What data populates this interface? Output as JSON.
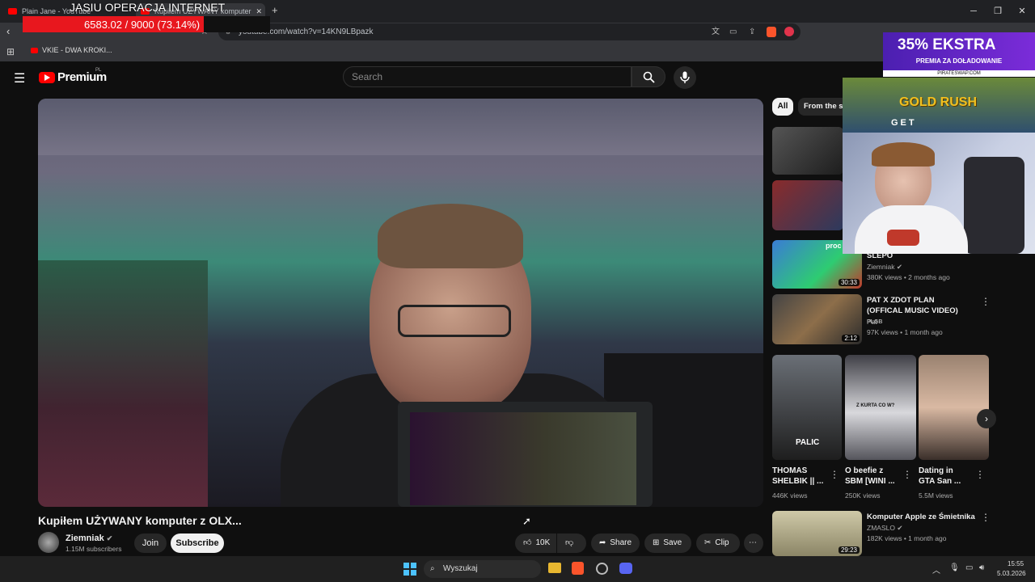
{
  "browser": {
    "tabs": [
      {
        "label": "Plain Jane - YouTube"
      },
      {
        "label": "Kupiłem UŻYWANY komputer"
      }
    ],
    "new_tab": "+",
    "url": "youtube.com/watch?v=14KN9LBpazk",
    "bookmark": "VKIE - DWA KROKI..."
  },
  "youtube": {
    "logo_text": "Premium",
    "logo_region": "PL",
    "search_placeholder": "Search",
    "video": {
      "title": "Kupiłem UŻYWANY komputer z OLX...",
      "channel": "Ziemniak",
      "subscribers": "1.15M subscribers",
      "join": "Join",
      "subscribe": "Subscribe",
      "likes": "10K",
      "share": "Share",
      "save": "Save",
      "clip": "Clip"
    },
    "chips": [
      "All",
      "From the se"
    ],
    "sidebar": [
      {
        "title": "SLEPO",
        "channel": "Ziemniak",
        "meta": "380K views • 2 months ago",
        "duration": "30:33",
        "thumb_text": "proc"
      },
      {
        "title": "PAT X ZDOT PLAN (OFFICAL MUSIC VIDEO)",
        "badge": "PLGB",
        "channel": "Pat",
        "meta": "97K views • 1 month ago",
        "duration": "2:12"
      },
      {
        "title": "Komputer Apple ze Śmietnika",
        "channel": "ZMASLO",
        "meta": "182K views • 1 month ago",
        "duration": "29:23"
      }
    ],
    "shorts": [
      {
        "title": "THOMAS SHELBIK || ...",
        "views": "446K views",
        "thumb_text": "PALIC",
        "color": "#3a2a20"
      },
      {
        "title": "O beefie z SBM [WINI ...",
        "views": "250K views",
        "thumb_text": "Z KURTA CO W?",
        "color": "#5a5e66"
      },
      {
        "title": "Dating in GTA San ...",
        "views": "5.5M views",
        "color": "#6e5444"
      }
    ]
  },
  "overlays": {
    "goal_title": "JASIU OPERACJA INTERNET",
    "goal_progress": "6583.02 / 9000 (73.14%)",
    "goal_fraction": 0.7314,
    "ad_line1": "35% EKSTRA",
    "ad_line2": "PREMIA ZA DOŁADOWANIE",
    "ad_domain": "PIRATESWAP.COM",
    "game_title": "GOLD RUSH",
    "game_sub": "GET"
  },
  "taskbar": {
    "search": "Wyszukaj",
    "time": "15:55",
    "date": "5.03.2026"
  },
  "colors": {
    "youtube_red": "#ff0000",
    "goal_bar": "#e8171e",
    "ad_purple": "#6a27c8"
  }
}
